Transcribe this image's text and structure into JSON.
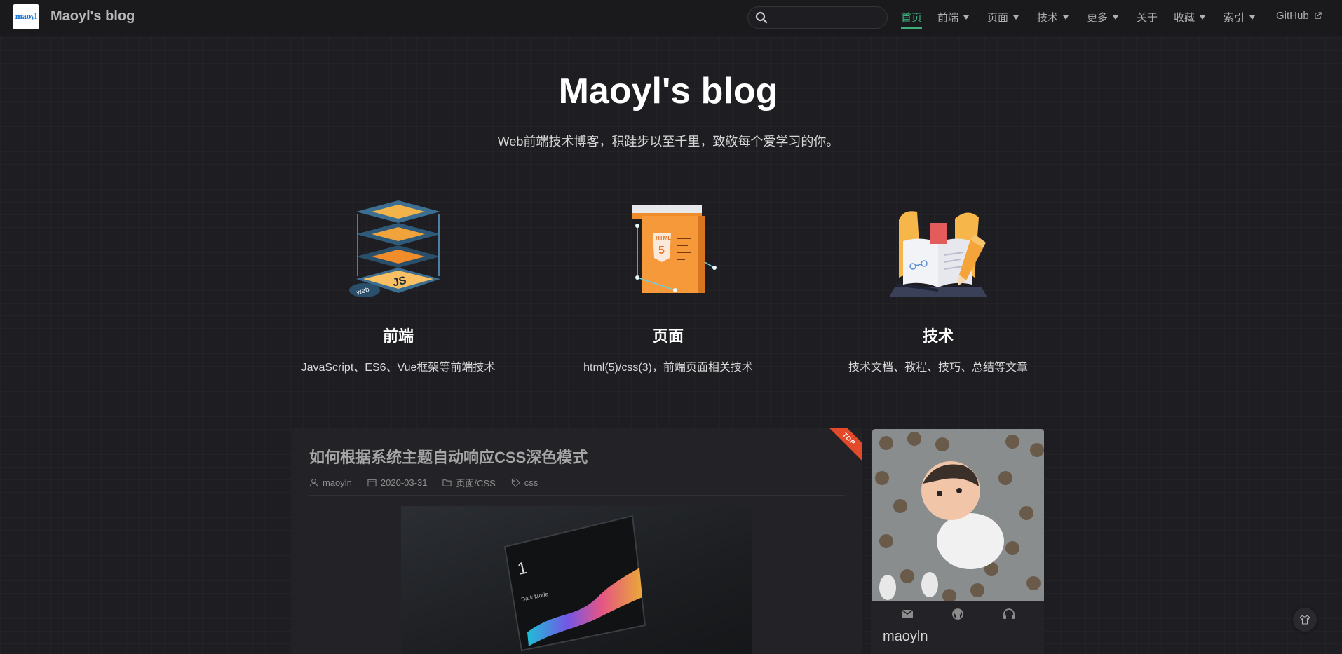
{
  "navbar": {
    "site_name": "Maoyl's blog",
    "logo_text": "maoyl",
    "search_placeholder": "",
    "items": [
      {
        "label": "首页",
        "active": true,
        "dropdown": false
      },
      {
        "label": "前端",
        "active": false,
        "dropdown": true
      },
      {
        "label": "页面",
        "active": false,
        "dropdown": true
      },
      {
        "label": "技术",
        "active": false,
        "dropdown": true
      },
      {
        "label": "更多",
        "active": false,
        "dropdown": true
      },
      {
        "label": "关于",
        "active": false,
        "dropdown": false
      },
      {
        "label": "收藏",
        "active": false,
        "dropdown": true
      },
      {
        "label": "索引",
        "active": false,
        "dropdown": true
      },
      {
        "label": "GitHub",
        "active": false,
        "dropdown": false,
        "external": true
      }
    ]
  },
  "hero": {
    "title": "Maoyl's blog",
    "subtitle": "Web前端技术博客，积跬步以至千里，致敬每个爱学习的你。"
  },
  "features": [
    {
      "title": "前端",
      "desc": "JavaScript、ES6、Vue框架等前端技术",
      "icon": "js-layers-icon"
    },
    {
      "title": "页面",
      "desc": "html(5)/css(3)，前端页面相关技术",
      "icon": "html5-page-icon"
    },
    {
      "title": "技术",
      "desc": "技术文档、教程、技巧、总结等文章",
      "icon": "book-pencil-icon"
    }
  ],
  "post": {
    "ribbon": "TOP",
    "title": "如何根据系统主题自动响应CSS深色模式",
    "author": "maoyln",
    "date": "2020-03-31",
    "category": "页面/CSS",
    "tag": "css",
    "cover_number": "1",
    "cover_caption": "Dark Mode"
  },
  "profile": {
    "name": "maoyln",
    "social": [
      "mail-icon",
      "github-icon",
      "headphones-icon"
    ]
  },
  "colors": {
    "accent": "#3eaf7c",
    "background": "#1e1e22",
    "card": "#232327",
    "ribbon": "#e24a2a"
  }
}
